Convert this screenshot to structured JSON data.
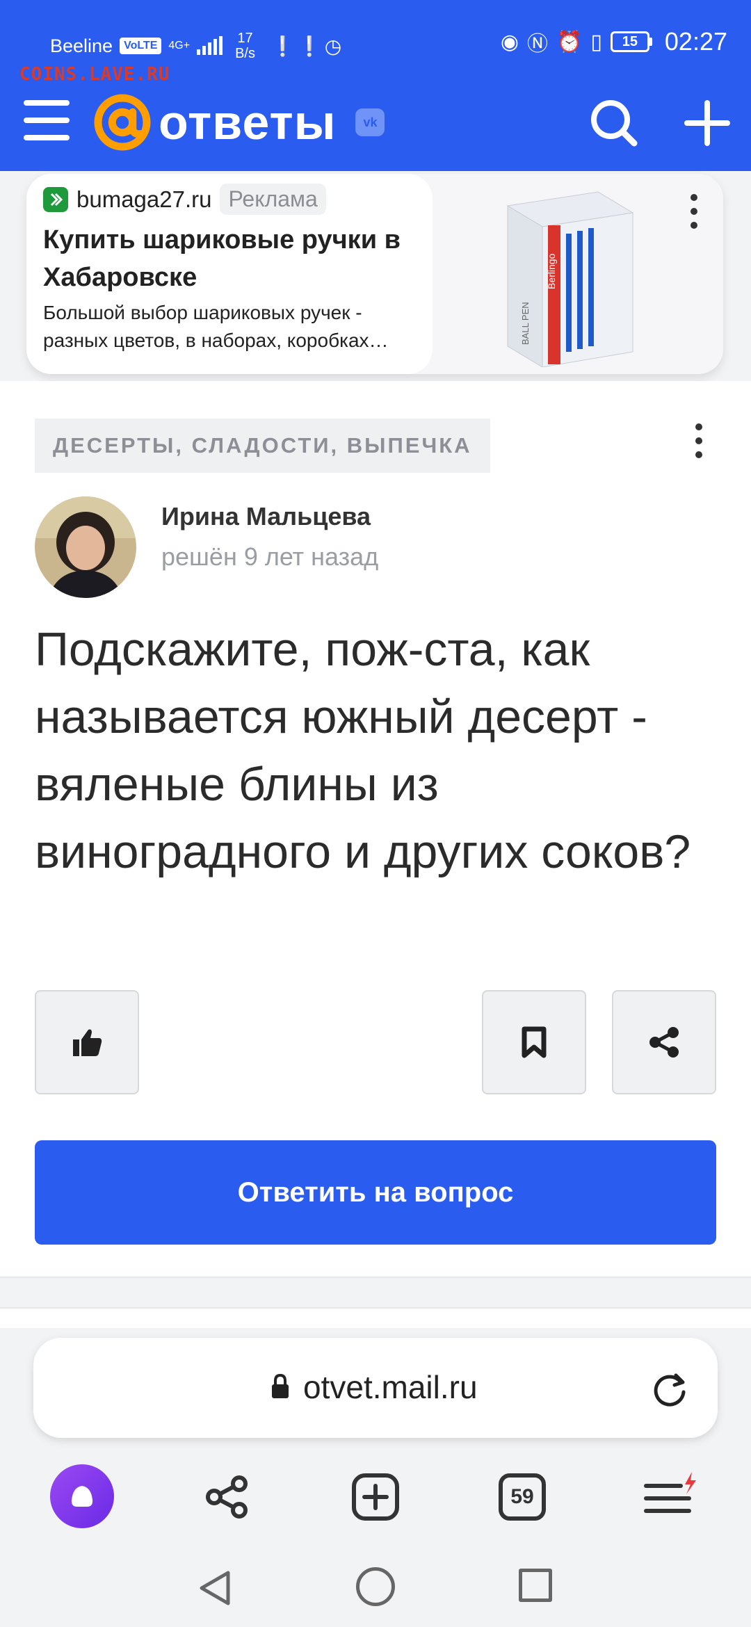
{
  "status_bar": {
    "carrier": "Beeline",
    "volte": "VoLTE",
    "network": "4G+",
    "speed_value": "17",
    "speed_unit": "B/s",
    "battery": "15",
    "time": "02:27"
  },
  "watermark": "COINS.LAVE.RU",
  "app": {
    "logo_text": "ответы",
    "vk_badge": "vk"
  },
  "ad": {
    "domain": "bumaga27.ru",
    "tag": "Реклама",
    "title": "Купить шариковые ручки в Хабаровске",
    "description": "Большой выбор шариковых ручек - разных цветов, в наборах, коробках…",
    "product_brand": "Berlingo",
    "product_name": "BALL PEN"
  },
  "question": {
    "category": "ДЕСЕРТЫ, СЛАДОСТИ, ВЫПЕЧКА",
    "author_name": "Ирина Мальцева",
    "meta": "решён 9 лет назад",
    "title": "Подскажите, пож-ста, как называется южный десерт - вяленые блины из виноградного и других соков?",
    "answer_button": "Ответить на вопрос"
  },
  "browser": {
    "url": "otvet.mail.ru",
    "tabs_count": "59"
  },
  "colors": {
    "brand_blue": "#2a5cf0",
    "logo_orange": "#ff9e00",
    "alice_purple": "#7b35ec"
  },
  "icons": [
    "menu-icon",
    "search-icon",
    "plus-icon",
    "more-vertical-icon",
    "thumbs-up-icon",
    "bookmark-icon",
    "share-icon",
    "lock-icon",
    "reload-icon",
    "alice-icon",
    "new-tab-icon",
    "tabs-icon",
    "browser-menu-icon",
    "back-icon",
    "home-icon",
    "recents-icon"
  ]
}
